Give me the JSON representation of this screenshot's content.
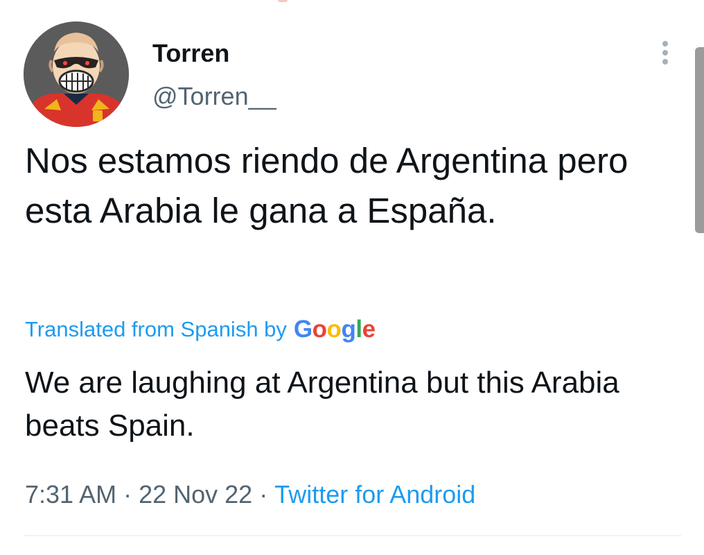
{
  "tweet": {
    "display_name": "Torren",
    "handle": "@Torren__",
    "text": "Nos estamos riendo de Argentina pero esta Arabia le gana a España.",
    "translation": {
      "label": "Translated from Spanish by",
      "provider_letters": [
        "G",
        "o",
        "o",
        "g",
        "l",
        "e"
      ],
      "provider_colors": [
        "#4285f4",
        "#ea4335",
        "#fbbc05",
        "#4285f4",
        "#34a853",
        "#ea4335"
      ],
      "text": "We are laughing at Argentina but this Arabia beats Spain."
    },
    "meta": {
      "time": "7:31 AM",
      "separator": "·",
      "date": "22 Nov 22",
      "source": "Twitter for Android"
    }
  },
  "icons": {
    "more": "more-vertical-icon",
    "avatar": "avatar-image"
  },
  "colors": {
    "text": "#0f1419",
    "secondary": "#536471",
    "link": "#1d9bf0",
    "divider": "#eff3f4"
  }
}
